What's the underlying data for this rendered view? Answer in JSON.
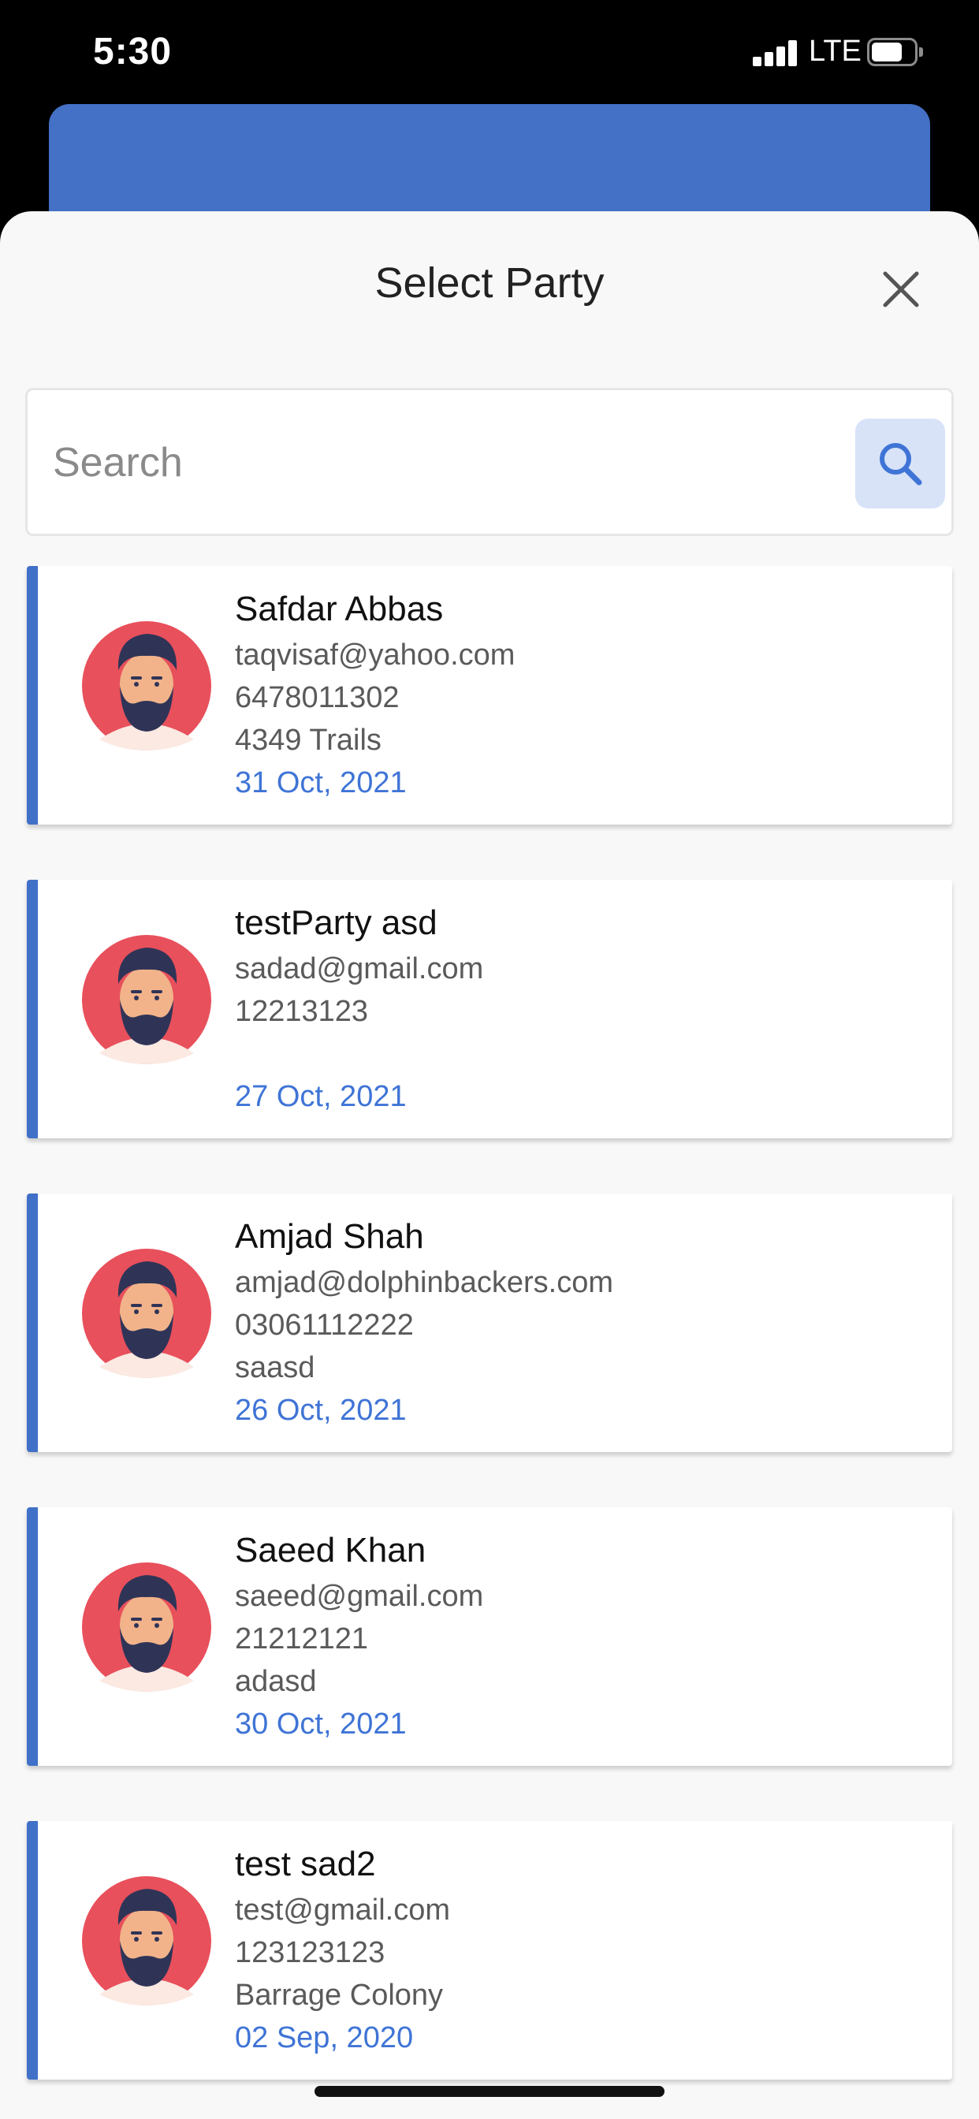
{
  "status_bar": {
    "time": "5:30",
    "network": "LTE"
  },
  "sheet": {
    "title": "Select Party"
  },
  "search": {
    "placeholder": "Search"
  },
  "colors": {
    "accent": "#4070c8",
    "date_text": "#3f74d6",
    "search_button_bg": "#d8e3f8",
    "header_card": "#4470c6",
    "avatar_bg": "#e8505b"
  },
  "parties": [
    {
      "name": "Safdar Abbas",
      "email": "taqvisaf@yahoo.com",
      "phone": "6478011302",
      "address": "4349 Trails",
      "date": "31 Oct, 2021"
    },
    {
      "name": "testParty asd",
      "email": "sadad@gmail.com",
      "phone": "12213123",
      "address": "",
      "date": "27 Oct, 2021"
    },
    {
      "name": "Amjad Shah",
      "email": "amjad@dolphinbackers.com",
      "phone": "03061112222",
      "address": "saasd",
      "date": "26 Oct, 2021"
    },
    {
      "name": "Saeed Khan",
      "email": "saeed@gmail.com",
      "phone": "21212121",
      "address": "adasd",
      "date": "30 Oct, 2021"
    },
    {
      "name": "test sad2",
      "email": "test@gmail.com",
      "phone": "123123123",
      "address": "Barrage Colony",
      "date": "02 Sep, 2020"
    }
  ]
}
